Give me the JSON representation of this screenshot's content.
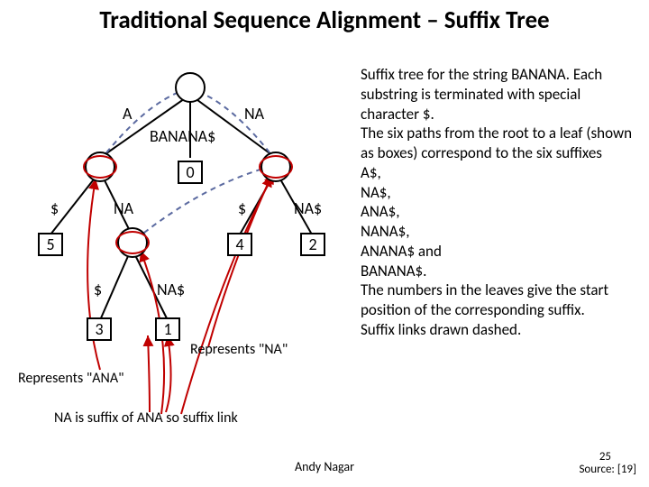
{
  "title": "Traditional Sequence Alignment – Suffix Tree",
  "edges": {
    "root_A": "A",
    "root_BANANA$": "BANANA$",
    "root_NA": "NA",
    "A_dollar": "$",
    "A_NA": "NA",
    "NA_dollar": "$",
    "NA_NA$": "NA$",
    "ANA_dollar": "$",
    "ANA_NA$": "NA$"
  },
  "leaves": {
    "l0": "0",
    "l5": "5",
    "l4": "4",
    "l2": "2",
    "l3": "3",
    "l1": "1"
  },
  "ann": {
    "rep_na": "Represents \"NA\"",
    "rep_ana": "Represents \"ANA\"",
    "suffixlink": "NA is suffix of ANA so suffix link"
  },
  "body": {
    "p1": "Suffix tree for the string BANANA. Each substring is terminated with special character $.",
    "p2": "The six paths from the root to a leaf (shown as boxes) correspond to the six suffixes",
    "s1": "A$,",
    "s2": "NA$,",
    "s3": "ANA$,",
    "s4": "NANA$,",
    "s5": "ANANA$ and",
    "s6": "BANANA$.",
    "p3": "The numbers in the leaves give the start position of the corresponding suffix.",
    "p4": "Suffix links drawn dashed."
  },
  "footer": {
    "author": "Andy Nagar",
    "source": "Source: [19]",
    "pagenum": "25"
  }
}
